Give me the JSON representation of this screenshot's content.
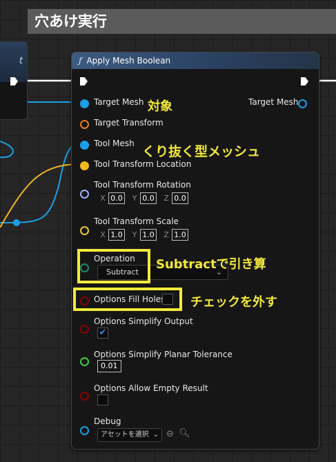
{
  "comment": {
    "title": "穴あけ実行"
  },
  "left_node": {
    "header_partial": "t",
    "pin_partial": "e"
  },
  "node": {
    "title": "Apply Mesh Boolean",
    "inputs": {
      "target_mesh": "Target Mesh",
      "target_transform": "Target Transform",
      "tool_mesh": "Tool Mesh",
      "tool_transform_location": "Tool Transform Location",
      "tool_transform_rotation": "Tool Transform Rotation",
      "tool_transform_scale": "Tool Transform Scale",
      "operation": "Operation",
      "options_fill_holes": "Options Fill Holes",
      "options_simplify_output": "Options Simplify Output",
      "options_simplify_planar_tolerance": "Options Simplify Planar Tolerance",
      "options_allow_empty_result": "Options Allow Empty Result",
      "debug": "Debug"
    },
    "output": {
      "target_mesh": "Target Mesh"
    },
    "rotation": {
      "x_label": "X",
      "x": "0.0",
      "y_label": "Y",
      "y": "0.0",
      "z_label": "Z",
      "z": "0.0"
    },
    "scale": {
      "x_label": "X",
      "x": "1.0",
      "y_label": "Y",
      "y": "1.0",
      "z_label": "Z",
      "z": "1.0"
    },
    "operation_value": "Subtract",
    "fill_holes_checked": false,
    "simplify_output_checked": true,
    "planar_tolerance": "0.01",
    "allow_empty_checked": false,
    "debug_select": "アセットを選択"
  },
  "annotations": {
    "target": "対象",
    "tool": "くり抜く型メッシュ",
    "operation": "Subtractで引き算",
    "fill_holes": "チェックを外す"
  },
  "colors": {
    "mesh_pin": "#1aa0e8",
    "transform_pin": "#e67e22",
    "location_pin": "#f2b81d",
    "rotation_pin": "#9fb0ff",
    "scale_pin": "#e8c33a",
    "enum_pin": "#1d8a6e",
    "bool_pin": "#8b0000",
    "float_pin": "#3ccf3c",
    "highlight": "#f4ea3c"
  }
}
